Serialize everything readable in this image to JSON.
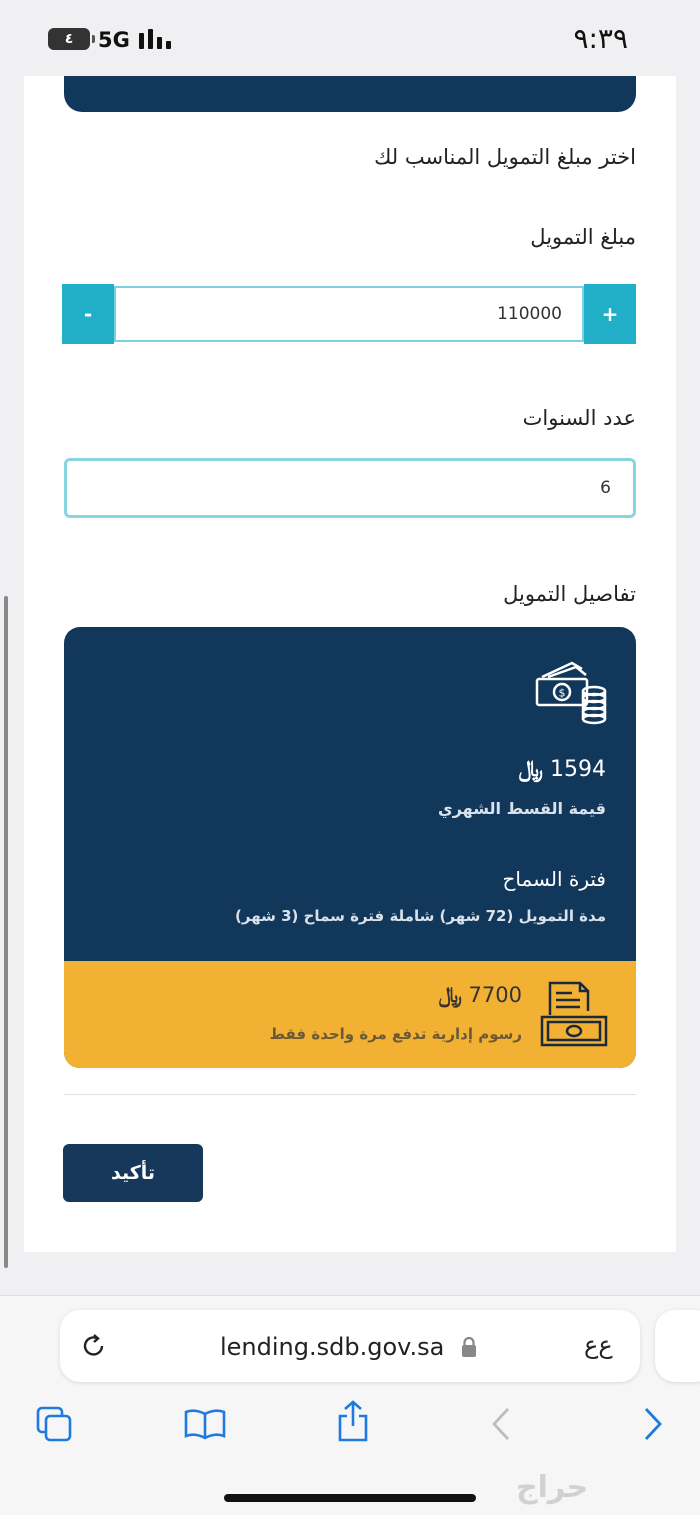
{
  "status_bar": {
    "time": "٩:٣٩",
    "network": "5G",
    "battery": "٤"
  },
  "form": {
    "choose_title": "اختر مبلغ التمويل المناسب لك",
    "amount_label": "مبلغ التمويل",
    "amount_value": "110000",
    "minus_label": "-",
    "plus_label": "+",
    "years_label": "عدد السنوات",
    "years_value": "6"
  },
  "details": {
    "title": "تفاصيل التمويل",
    "monthly_amount": "1594",
    "monthly_label": "قيمة القسط الشهري",
    "grace_title": "فترة السماح",
    "grace_text": "مدة التمويل (72 شهر) شاملة فترة سماح (3 شهر)",
    "fees_amount": "7700",
    "fees_label": "رسوم إدارية تدفع مرة واحدة فقط",
    "currency_symbol": "﷼"
  },
  "confirm_label": "تأكيد",
  "browser": {
    "url": "lending.sdb.gov.sa",
    "text_size_label": "ﻉﻉ"
  },
  "watermark": "حراج",
  "colors": {
    "navy": "#11375a",
    "teal": "#21afc8",
    "gold": "#f2b132"
  }
}
